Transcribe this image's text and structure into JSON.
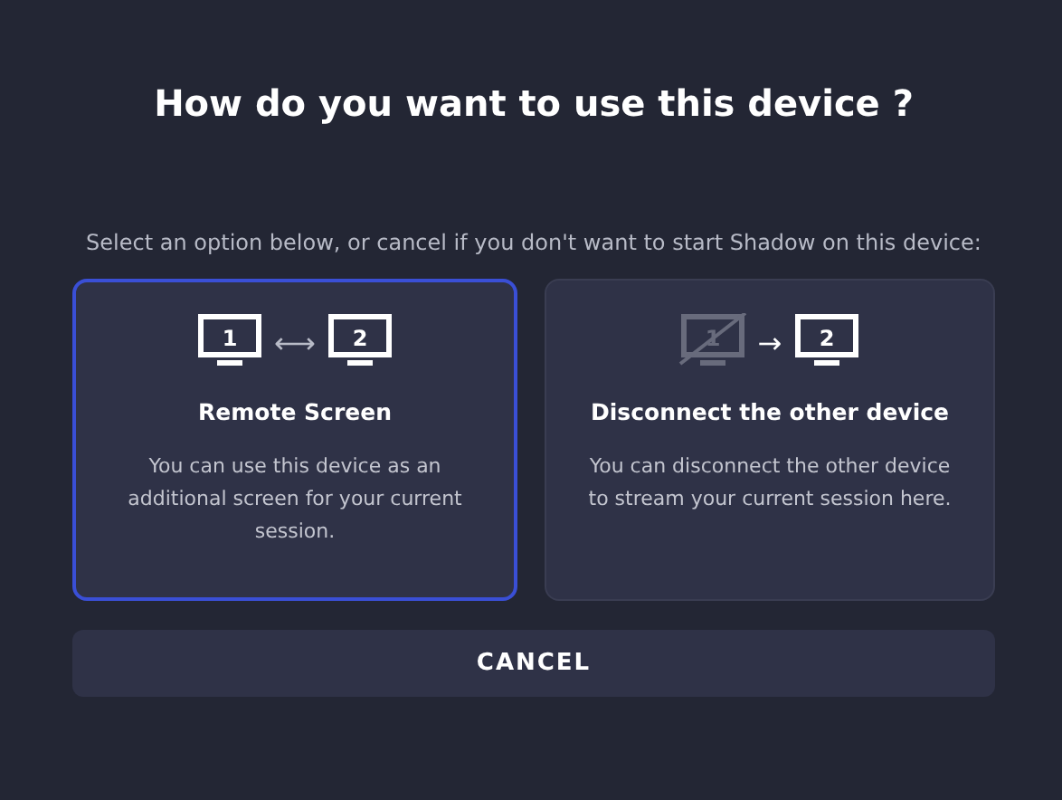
{
  "title": "How do you want to use this device ?",
  "subtitle": "Select an option below, or cancel if you don't want to start Shadow on this device:",
  "options": [
    {
      "selected": true,
      "screens": [
        {
          "number": "1",
          "disabled": false
        },
        {
          "number": "2",
          "disabled": false
        }
      ],
      "arrow": "⟷",
      "title": "Remote Screen",
      "description": "You can use this device as an additional screen for your current session."
    },
    {
      "selected": false,
      "screens": [
        {
          "number": "1",
          "disabled": true
        },
        {
          "number": "2",
          "disabled": false
        }
      ],
      "arrow": "→",
      "title": "Disconnect the other device",
      "description": "You can disconnect the other device to stream your current session here."
    }
  ],
  "cancel": "CANCEL"
}
